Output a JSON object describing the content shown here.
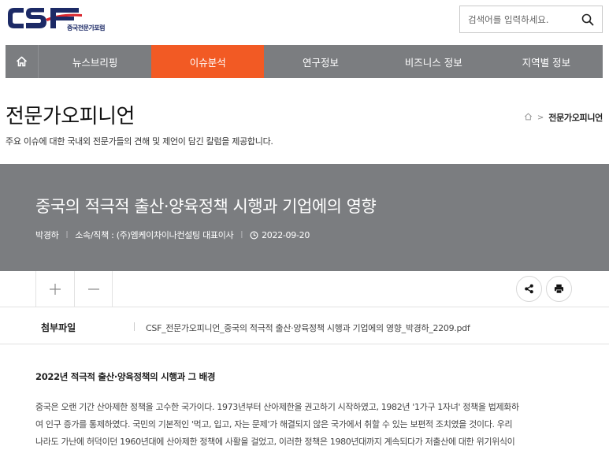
{
  "header": {
    "logo_text": "CSF",
    "logo_subtitle": "중국전문가포럼",
    "search": {
      "placeholder": "검색어를 입력하세요.",
      "value": ""
    }
  },
  "nav": {
    "items": [
      {
        "label": "뉴스브리핑",
        "active": false
      },
      {
        "label": "이슈분석",
        "active": true
      },
      {
        "label": "연구정보",
        "active": false
      },
      {
        "label": "비즈니스 정보",
        "active": false
      },
      {
        "label": "지역별 정보",
        "active": false
      }
    ]
  },
  "page": {
    "title": "전문가오피니언",
    "description": "주요 이슈에 대한 국내외 전문가들의 견해 및 제언이 담긴 칼럼을 제공합니다.",
    "breadcrumb_current": "전문가오피니언"
  },
  "article": {
    "title": "중국의 적극적 출산·양육정책 시행과 기업에의 영향",
    "author": "박경하",
    "affiliation": "소속/직책 : (주)엠케이차이나컨설팅 대표이사",
    "date": "2022-09-20",
    "attachment_label": "첨부파일",
    "attachment_file": "CSF_전문가오피니언_중국의 적극적 출산·양육정책 시행과 기업에의 영향_박경하_2209.pdf",
    "section_heading": "2022년 적극적 출산·양육정책의 시행과 그 배경",
    "paragraph_lines": [
      "중국은 오랜 기간 산아제한 정책을 고수한 국가이다. 1973년부터 산아제한을 권고하기 시작하였고, 1982년 '1가구 1자녀' 정책을 법제화하",
      "여 인구 증가를 통제하였다. 국민의 기본적인 '먹고, 입고, 자는 문제'가 해결되지 않은 국가에서 취할 수 있는 보편적 조치였을 것이다. 우리",
      "나라도 가난에 허덕이던 1960년대에 산아제한 정책에 사활을 걸었고, 이러한 정책은 1980년대까지 계속되다가 저출산에 대한 위기위식이"
    ]
  },
  "colors": {
    "brand_navy": "#1c2a66",
    "brand_red": "#d9262e",
    "nav_gray": "#7b7d80",
    "nav_active": "#f25a24"
  },
  "icons": {
    "search": "search-icon",
    "home": "home-icon",
    "share": "share-icon",
    "print": "print-icon",
    "clock": "clock-icon",
    "plus": "plus-icon",
    "minus": "minus-icon"
  }
}
